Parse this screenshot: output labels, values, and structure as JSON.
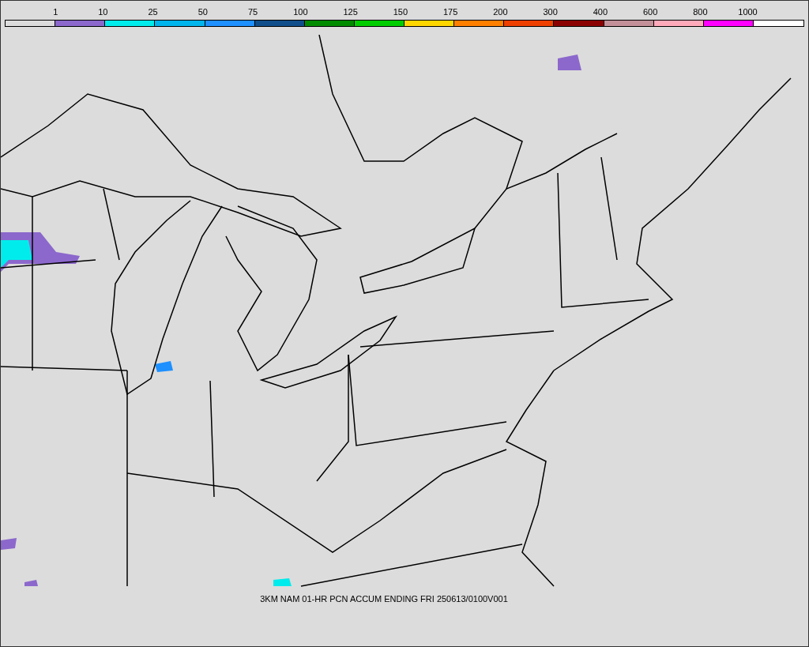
{
  "legend": {
    "thresholds": [
      "1",
      "10",
      "25",
      "50",
      "75",
      "100",
      "125",
      "150",
      "175",
      "200",
      "300",
      "400",
      "600",
      "800",
      "1000"
    ],
    "bins": [
      {
        "color": "#dcdcdc"
      },
      {
        "color": "#8c68cc"
      },
      {
        "color": "#00ecec"
      },
      {
        "color": "#00b4ec"
      },
      {
        "color": "#1e90ff"
      },
      {
        "color": "#104e8b"
      },
      {
        "color": "#008b00"
      },
      {
        "color": "#00cd00"
      },
      {
        "color": "#ffd700"
      },
      {
        "color": "#ff8000"
      },
      {
        "color": "#ee4000"
      },
      {
        "color": "#8b0000"
      },
      {
        "color": "#c39099"
      },
      {
        "color": "#ffaabb"
      },
      {
        "color": "#ff00ff"
      },
      {
        "color": "#ffffff"
      }
    ]
  },
  "caption": "3KM NAM 01-HR PCN ACCUM ENDING FRI 250613/0100V001"
}
